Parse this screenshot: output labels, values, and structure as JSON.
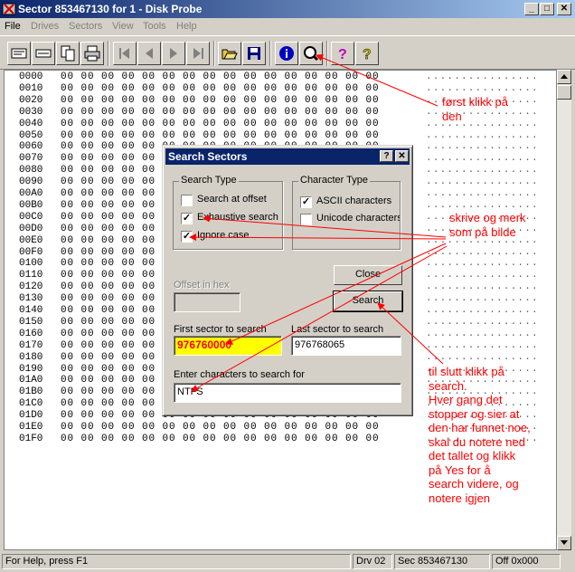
{
  "window": {
    "title": "Sector 853467130 for 1 - Disk Probe",
    "min": "_",
    "max": "□",
    "close": "✕"
  },
  "menu": [
    {
      "label": "File",
      "enabled": true
    },
    {
      "label": "Drives",
      "enabled": false
    },
    {
      "label": "Sectors",
      "enabled": false
    },
    {
      "label": "View",
      "enabled": false
    },
    {
      "label": "Tools",
      "enabled": false
    },
    {
      "label": "Help",
      "enabled": false
    }
  ],
  "toolbar_icons": [
    "read-icon",
    "write-icon",
    "copy-icon",
    "print-icon",
    "first-sector-icon",
    "previous-sector-icon",
    "next-sector-icon",
    "last-sector-icon",
    "open-icon",
    "save-icon",
    "info-icon",
    "search-icon",
    "help-icon",
    "context-help-icon"
  ],
  "hex_rows": [
    {
      "offset": "0000",
      "bytes": "00 00 00 00 00 00 00 00 00 00 00 00 00 00 00 00",
      "ascii": "................"
    },
    {
      "offset": "0010",
      "bytes": "00 00 00 00 00 00 00 00 00 00 00 00 00 00 00 00",
      "ascii": "................"
    },
    {
      "offset": "0020",
      "bytes": "00 00 00 00 00 00 00 00 00 00 00 00 00 00 00 00",
      "ascii": "................"
    },
    {
      "offset": "0030",
      "bytes": "00 00 00 00 00 00 00 00 00 00 00 00 00 00 00 00",
      "ascii": "................"
    },
    {
      "offset": "0040",
      "bytes": "00 00 00 00 00 00 00 00 00 00 00 00 00 00 00 00",
      "ascii": "................"
    },
    {
      "offset": "0050",
      "bytes": "00 00 00 00 00 00 00 00 00 00 00 00 00 00 00 00",
      "ascii": "................"
    },
    {
      "offset": "0060",
      "bytes": "00 00 00 00 00 00 00 00 00 00 00 00 00 00 00 00",
      "ascii": "................"
    },
    {
      "offset": "0070",
      "bytes": "00 00 00 00 00 00 00 00 00 00 00 00 00 00 00 00",
      "ascii": "................"
    },
    {
      "offset": "0080",
      "bytes": "00 00 00 00 00 00 00 00 00 00 00 00 00 00 00 00",
      "ascii": "................"
    },
    {
      "offset": "0090",
      "bytes": "00 00 00 00 00 00 00 00 00 00 00 00 00 00 00 00",
      "ascii": "................"
    },
    {
      "offset": "00A0",
      "bytes": "00 00 00 00 00 00 00 00 00 00 00 00 00 00 00 00",
      "ascii": "................"
    },
    {
      "offset": "00B0",
      "bytes": "00 00 00 00 00 00 00 00 00 00 00 00 00 00 00 00",
      "ascii": "................"
    },
    {
      "offset": "00C0",
      "bytes": "00 00 00 00 00 00 00 00 00 00 00 00 00 00 00 00",
      "ascii": "................"
    },
    {
      "offset": "00D0",
      "bytes": "00 00 00 00 00 00 00 00 00 00 00 00 00 00 00 00",
      "ascii": "................"
    },
    {
      "offset": "00E0",
      "bytes": "00 00 00 00 00 00 00 00 00 00 00 00 00 00 00 00",
      "ascii": "................"
    },
    {
      "offset": "00F0",
      "bytes": "00 00 00 00 00 00 00 00 00 00 00 00 00 00 00 00",
      "ascii": "................"
    },
    {
      "offset": "0100",
      "bytes": "00 00 00 00 00 00 00 00 00 00 00 00 00 00 00 00",
      "ascii": "................"
    },
    {
      "offset": "0110",
      "bytes": "00 00 00 00 00 00 00 00 00 00 00 00 00 00 00 00",
      "ascii": "................"
    },
    {
      "offset": "0120",
      "bytes": "00 00 00 00 00 00 00 00 00 00 00 00 00 00 00 00",
      "ascii": "................"
    },
    {
      "offset": "0130",
      "bytes": "00 00 00 00 00 00 00 00 00 00 00 00 00 00 00 00",
      "ascii": "................"
    },
    {
      "offset": "0140",
      "bytes": "00 00 00 00 00 00 00 00 00 00 00 00 00 00 00 00",
      "ascii": "................"
    },
    {
      "offset": "0150",
      "bytes": "00 00 00 00 00 00 00 00 00 00 00 00 00 00 00 00",
      "ascii": "................"
    },
    {
      "offset": "0160",
      "bytes": "00 00 00 00 00 00 00 00 00 00 00 00 00 00 00 00",
      "ascii": "................"
    },
    {
      "offset": "0170",
      "bytes": "00 00 00 00 00 00 00 00 00 00 00 00 00 00 00 00",
      "ascii": "................"
    },
    {
      "offset": "0180",
      "bytes": "00 00 00 00 00 00 00 00 00 00 00 00 00 00 00 00",
      "ascii": "................"
    },
    {
      "offset": "0190",
      "bytes": "00 00 00 00 00 00 00 00 00 00 00 00 00 00 00 00",
      "ascii": "................"
    },
    {
      "offset": "01A0",
      "bytes": "00 00 00 00 00 00 00 00 00 00 00 00 00 00 00 00",
      "ascii": "................"
    },
    {
      "offset": "01B0",
      "bytes": "00 00 00 00 00 00 00 00 00 00 00 00 00 00 00 00",
      "ascii": "................"
    },
    {
      "offset": "01C0",
      "bytes": "00 00 00 00 00 00 00 00 00 00 00 00 00 00 00 00",
      "ascii": "................"
    },
    {
      "offset": "01D0",
      "bytes": "00 00 00 00 00 00 00 00 00 00 00 00 00 00 00 00",
      "ascii": "................"
    },
    {
      "offset": "01E0",
      "bytes": "00 00 00 00 00 00 00 00 00 00 00 00 00 00 00 00",
      "ascii": "................"
    },
    {
      "offset": "01F0",
      "bytes": "00 00 00 00 00 00 00 00 00 00 00 00 00 00 00 00",
      "ascii": "................"
    }
  ],
  "statusbar": {
    "help": "For Help, press F1",
    "drive": "Drv  02",
    "sector": "Sec 853467130",
    "offset": "Off 0x000"
  },
  "dialog": {
    "title": "Search Sectors",
    "help_btn": "?",
    "close_btn": "✕",
    "search_type": {
      "label": "Search Type",
      "options": [
        {
          "label": "Search at offset",
          "checked": false
        },
        {
          "label": "Exhaustive search",
          "checked": true
        },
        {
          "label": "Ignore case",
          "checked": true
        }
      ]
    },
    "character_type": {
      "label": "Character Type",
      "options": [
        {
          "label": "ASCII characters",
          "checked": true
        },
        {
          "label": "Unicode characters",
          "checked": false
        }
      ]
    },
    "close_label": "Close",
    "search_label": "Search",
    "offset_label": "Offset in hex",
    "offset_value": "",
    "first_sector_label": "First sector to search",
    "first_sector_value": "976760000",
    "last_sector_label": "Last sector to search",
    "last_sector_value": "976768065",
    "chars_label": "Enter characters to search for",
    "chars_value": "NTFS"
  },
  "annotations": {
    "first": "først klikk på\nden",
    "second": "skrive og merk\nsom på bilde",
    "third": "til slutt klikk på\nsearch.\nHver gang det\nstopper og sier at\nden har funnet noe,\nskal du notere ned\ndet tallet og klikk\npå Yes for å\nsearch videre, og\nnotere igjen",
    "color": "#ff0000"
  },
  "colors": {
    "titlebar": "#0a246a",
    "face": "#d4d0c8",
    "highlight": "#ffff00",
    "annotation": "#ff0000"
  }
}
